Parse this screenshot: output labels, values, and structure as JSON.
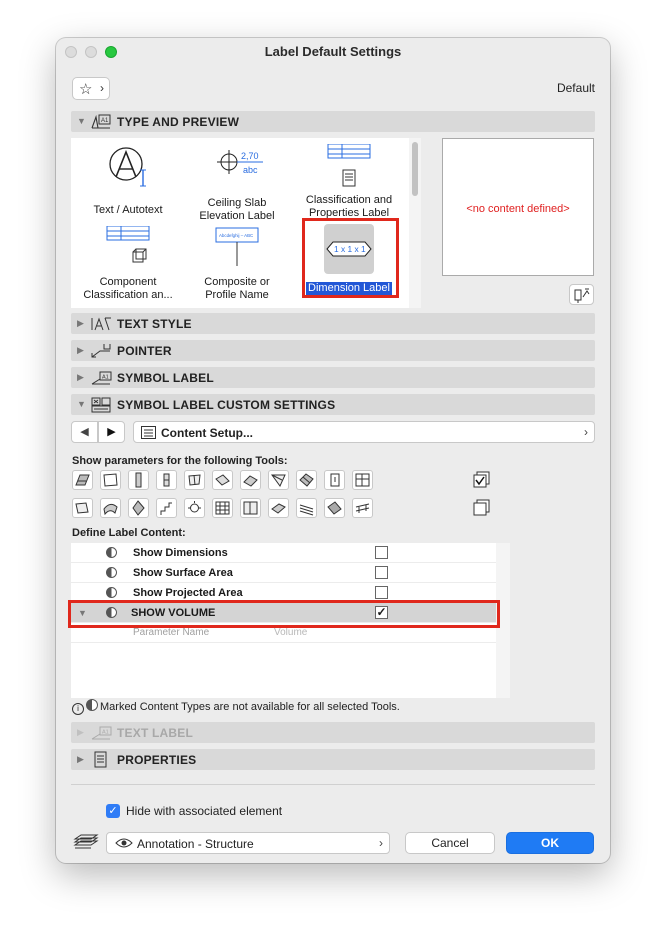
{
  "window": {
    "title": "Label Default Settings"
  },
  "header": {
    "favorites_caret": "›",
    "favorites_star": "☆",
    "default_label": "Default"
  },
  "sections": {
    "type_preview": "TYPE AND PREVIEW",
    "text_style": "TEXT STYLE",
    "pointer": "POINTER",
    "symbol_label": "SYMBOL LABEL",
    "symbol_custom": "SYMBOL LABEL CUSTOM SETTINGS",
    "text_label": "TEXT LABEL",
    "properties": "PROPERTIES"
  },
  "gallery": {
    "items": [
      {
        "label1": "Text / Autotext",
        "label2": ""
      },
      {
        "label1": "Ceiling Slab",
        "label2": "Elevation Label",
        "icon_text1": "2,70",
        "icon_text2": "abc"
      },
      {
        "label1": "Classification and",
        "label2": "Properties Label"
      },
      {
        "label1": "Component",
        "label2": "Classification an..."
      },
      {
        "label1": "Composite or",
        "label2": "Profile Name",
        "icon_text1": "Abcdefghij – ABC"
      },
      {
        "label1": "Dimension Label",
        "label2": "",
        "icon_text1": "1 x 1 x 1"
      }
    ]
  },
  "preview": {
    "no_content": "<no content defined>"
  },
  "nav": {
    "prev": "◀",
    "next": "▶",
    "content_setup": "Content Setup...",
    "arrow": "›"
  },
  "tools": {
    "header": "Show parameters for the following Tools:"
  },
  "define": {
    "header": "Define Label Content:",
    "rows": [
      {
        "label": "Show Dimensions",
        "check": ""
      },
      {
        "label": "Show Surface Area",
        "check": ""
      },
      {
        "label": "Show Projected Area",
        "check": ""
      },
      {
        "label": "SHOW VOLUME",
        "check": "✓"
      }
    ],
    "param_name_label": "Parameter Name",
    "param_name_value": "Volume"
  },
  "note": {
    "text": "Marked Content Types are not available for all selected Tools.",
    "info": "i"
  },
  "footer": {
    "hide_label": "Hide with associated element",
    "hide_check": "✓",
    "layer": "Annotation - Structure",
    "layer_arrow": "›",
    "cancel": "Cancel",
    "ok": "OK"
  },
  "colors": {
    "accent": "#1f7bf4",
    "highlight_box": "#e0281c",
    "no_content": "#e02020",
    "selection": "#2257d6"
  }
}
